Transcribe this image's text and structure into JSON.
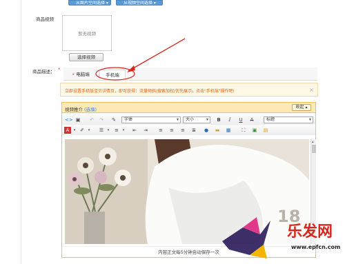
{
  "top_buttons": [
    {
      "label": "从图片空间选择 ▾"
    },
    {
      "label": "从视频空间选择 ▾"
    }
  ],
  "video": {
    "label": "商品视频",
    "placeholder": "暂无视频",
    "select_button": "选择视频"
  },
  "description": {
    "label": "商品描述：",
    "required_mark": "*",
    "tabs": [
      {
        "label": "电脑端",
        "active": false
      },
      {
        "label": "手机端",
        "active": true
      }
    ]
  },
  "notice": {
    "text": "立即设置手机版宝贝详情页，即可获得：流量倾斜/搜索加权/优先展示，点击\"手机端\"操作吧!",
    "close": "×"
  },
  "editor": {
    "title": "视频推介",
    "title_link": "(选填)",
    "collapse_button": "收起 ▴",
    "font_family": "字体",
    "font_size": "大小",
    "heading": "标题",
    "status_text": "内容正文每5分钟自动保存一次"
  },
  "watermark": {
    "text": "乐发网",
    "url": "www.epfcn.com",
    "number": "18"
  },
  "colors": {
    "accent_blue": "#5b9bd5",
    "notice_orange": "#e8600b",
    "editor_border": "#f0c060",
    "annotation_red": "#d9261c"
  }
}
